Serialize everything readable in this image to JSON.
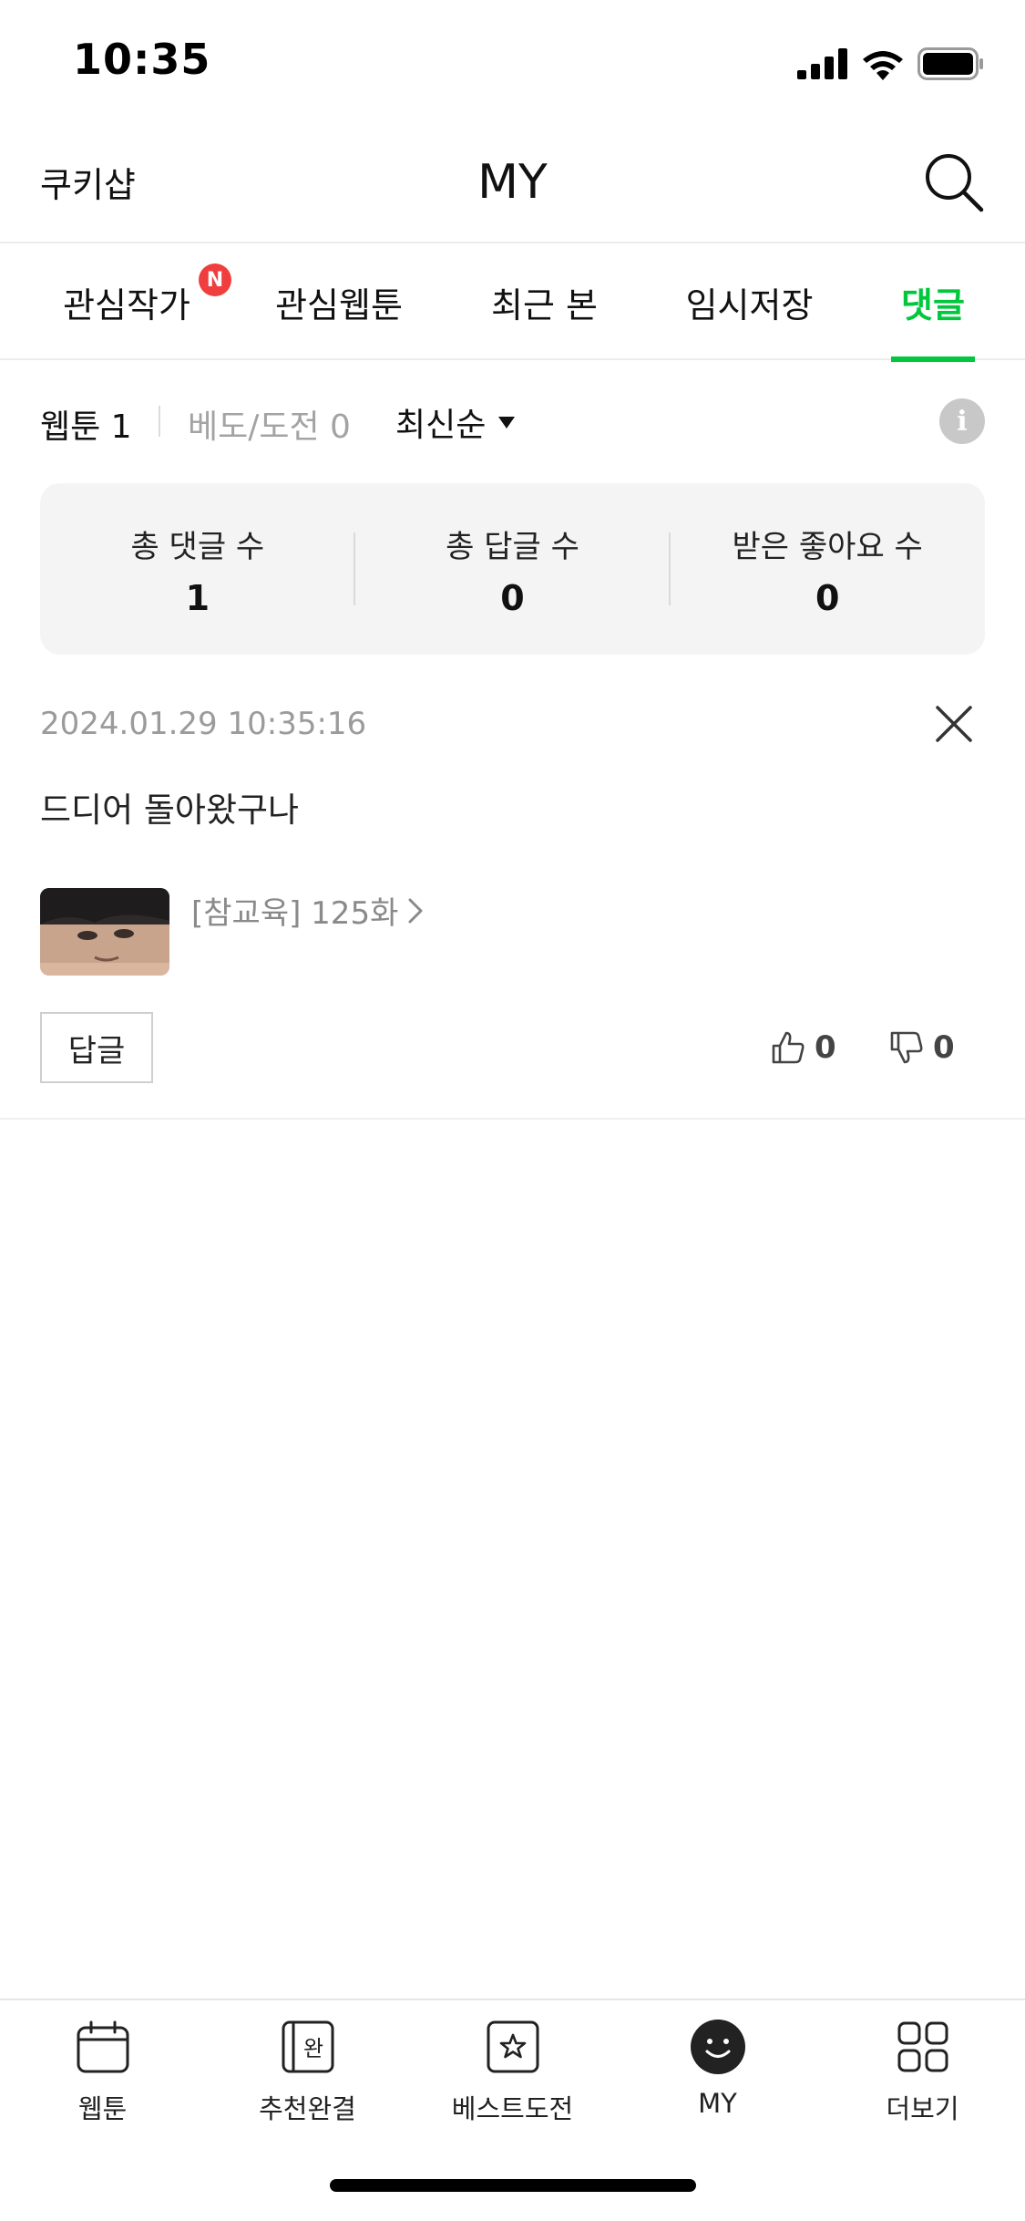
{
  "status_bar": {
    "time": "10:35"
  },
  "header": {
    "shop_label": "쿠키샵",
    "title": "MY"
  },
  "tabs": [
    {
      "label": "관심작가",
      "badge": "N"
    },
    {
      "label": "관심웹툰"
    },
    {
      "label": "최근 본"
    },
    {
      "label": "임시저장"
    },
    {
      "label": "댓글",
      "active": true
    }
  ],
  "filter": {
    "webtoon_label": "웹툰 1",
    "challenge_label": "베도/도전 0",
    "sort_label": "최신순",
    "info_icon": "i"
  },
  "stats": [
    {
      "label": "총 댓글 수",
      "value": "1"
    },
    {
      "label": "총 답글 수",
      "value": "0"
    },
    {
      "label": "받은 좋아요 수",
      "value": "0"
    }
  ],
  "comment": {
    "date": "2024.01.29 10:35:16",
    "text": "드디어 돌아왔구나",
    "work_title": "[참교육] 125화",
    "reply_label": "답글",
    "likes": "0",
    "dislikes": "0"
  },
  "bottom_nav": [
    {
      "label": "웹툰",
      "icon": "calendar-icon"
    },
    {
      "label": "추천완결",
      "icon": "book-complete-icon",
      "icon_text": "완"
    },
    {
      "label": "베스트도전",
      "icon": "star-box-icon"
    },
    {
      "label": "MY",
      "icon": "smile-avatar-icon",
      "active": true
    },
    {
      "label": "더보기",
      "icon": "grid-icon"
    }
  ],
  "colors": {
    "accent": "#00c73c",
    "badge": "#f03e3e"
  }
}
